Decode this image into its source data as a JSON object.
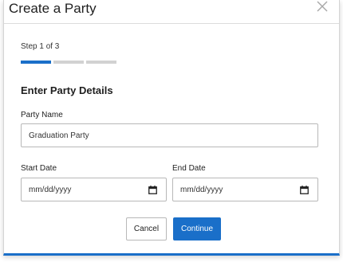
{
  "dialog": {
    "title": "Create a Party",
    "close_icon": "close-icon"
  },
  "stepper": {
    "label": "Step 1 of 3",
    "current_step": 1,
    "total_steps": 3,
    "active_color": "#1a6fc9",
    "inactive_color": "#d2d2d2"
  },
  "form": {
    "section_title": "Enter Party Details",
    "party_name": {
      "label": "Party Name",
      "value": "Graduation Party"
    },
    "start_date": {
      "label": "Start Date",
      "placeholder": "mm/dd/yyyy",
      "icon": "calendar-icon"
    },
    "end_date": {
      "label": "End Date",
      "placeholder": "mm/dd/yyyy",
      "icon": "calendar-icon"
    }
  },
  "actions": {
    "cancel_label": "Cancel",
    "continue_label": "Continue",
    "primary_color": "#1a6fc9"
  }
}
